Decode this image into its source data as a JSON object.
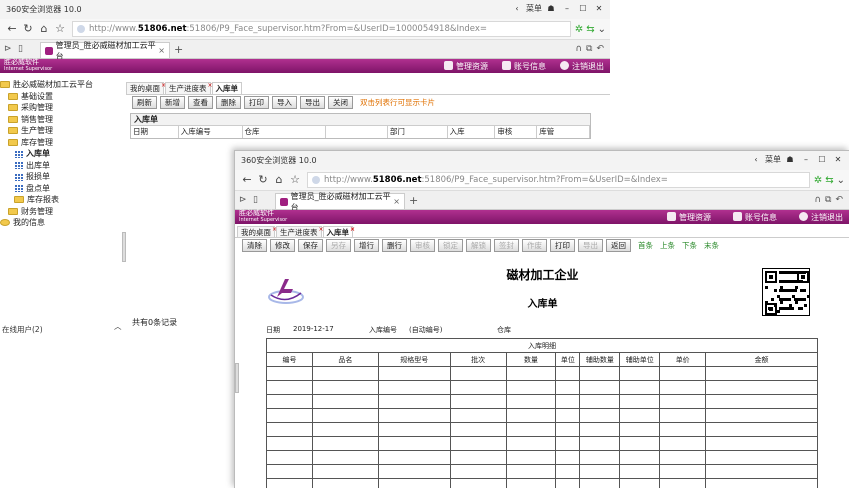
{
  "browser": {
    "title": "360安全浏览器 10.0",
    "menu_label": "菜单",
    "url_prefix": "http://www.",
    "url_domain": "51806.net",
    "url_rest": ":51806/P9_Face_supervisor.htm?From=&UserID=1000054918&Index=",
    "url_rest2": ":51806/P9_Face_supervisor.htm?From=&UserID=&Index=",
    "tab_title": "管理员_胜必威磁材加工云平台"
  },
  "app": {
    "logo_name": "胜必威软件",
    "logo_sub": "Internet Supervisor",
    "links": [
      "管理资源",
      "账号信息",
      "注销退出"
    ]
  },
  "tree": {
    "root": "胜必威磁材加工云平台",
    "items": [
      "基础设置",
      "采购管理",
      "销售管理",
      "生产管理",
      "库存管理"
    ],
    "sub": [
      "入库单",
      "出库单",
      "报损单",
      "盘点单",
      "库存报表"
    ],
    "after": [
      "财务管理",
      "我的信息"
    ],
    "online": "在线用户(2)",
    "collapse": "︿"
  },
  "w1": {
    "subtabs": [
      "我的桌面",
      "生产进度表",
      "入库单"
    ],
    "buttons": [
      "刷新",
      "新增",
      "查看",
      "删除",
      "打印",
      "导入",
      "导出",
      "关闭"
    ],
    "hint": "双击列表行可显示卡片",
    "panel_title": "入库单",
    "cols": [
      "日期",
      "入库编号",
      "仓库",
      "",
      "部门",
      "入库",
      "审核",
      "库管"
    ],
    "count": "共有0条记录"
  },
  "w2": {
    "subtabs": [
      "我的桌面",
      "生产进度表",
      "入库单"
    ],
    "buttons": [
      "清除",
      "修改",
      "保存",
      "另存",
      "增行",
      "删行",
      "审核",
      "锁定",
      "解锁",
      "签封",
      "作废",
      "打印",
      "导出",
      "返回"
    ],
    "disabled": [
      3,
      6,
      7,
      8,
      9,
      10,
      12
    ],
    "nav": [
      "首条",
      "上条",
      "下条",
      "末条"
    ],
    "company": "磁材加工企业",
    "doc_title": "入库单",
    "date_label": "日期",
    "date_value": "2019-12-17",
    "no_label": "入库编号",
    "no_value": "(自动编号)",
    "wh_label": "仓库",
    "detail_title": "入库明细",
    "cols": [
      "编号",
      "品名",
      "规格型号",
      "批次",
      "数量",
      "单位",
      "辅助数量",
      "辅助单位",
      "单价",
      "金额"
    ],
    "empty_rows": 9
  },
  "colors": {
    "brand": "#9c2080",
    "hint": "#e07000",
    "nav": "#2a8a2a"
  }
}
